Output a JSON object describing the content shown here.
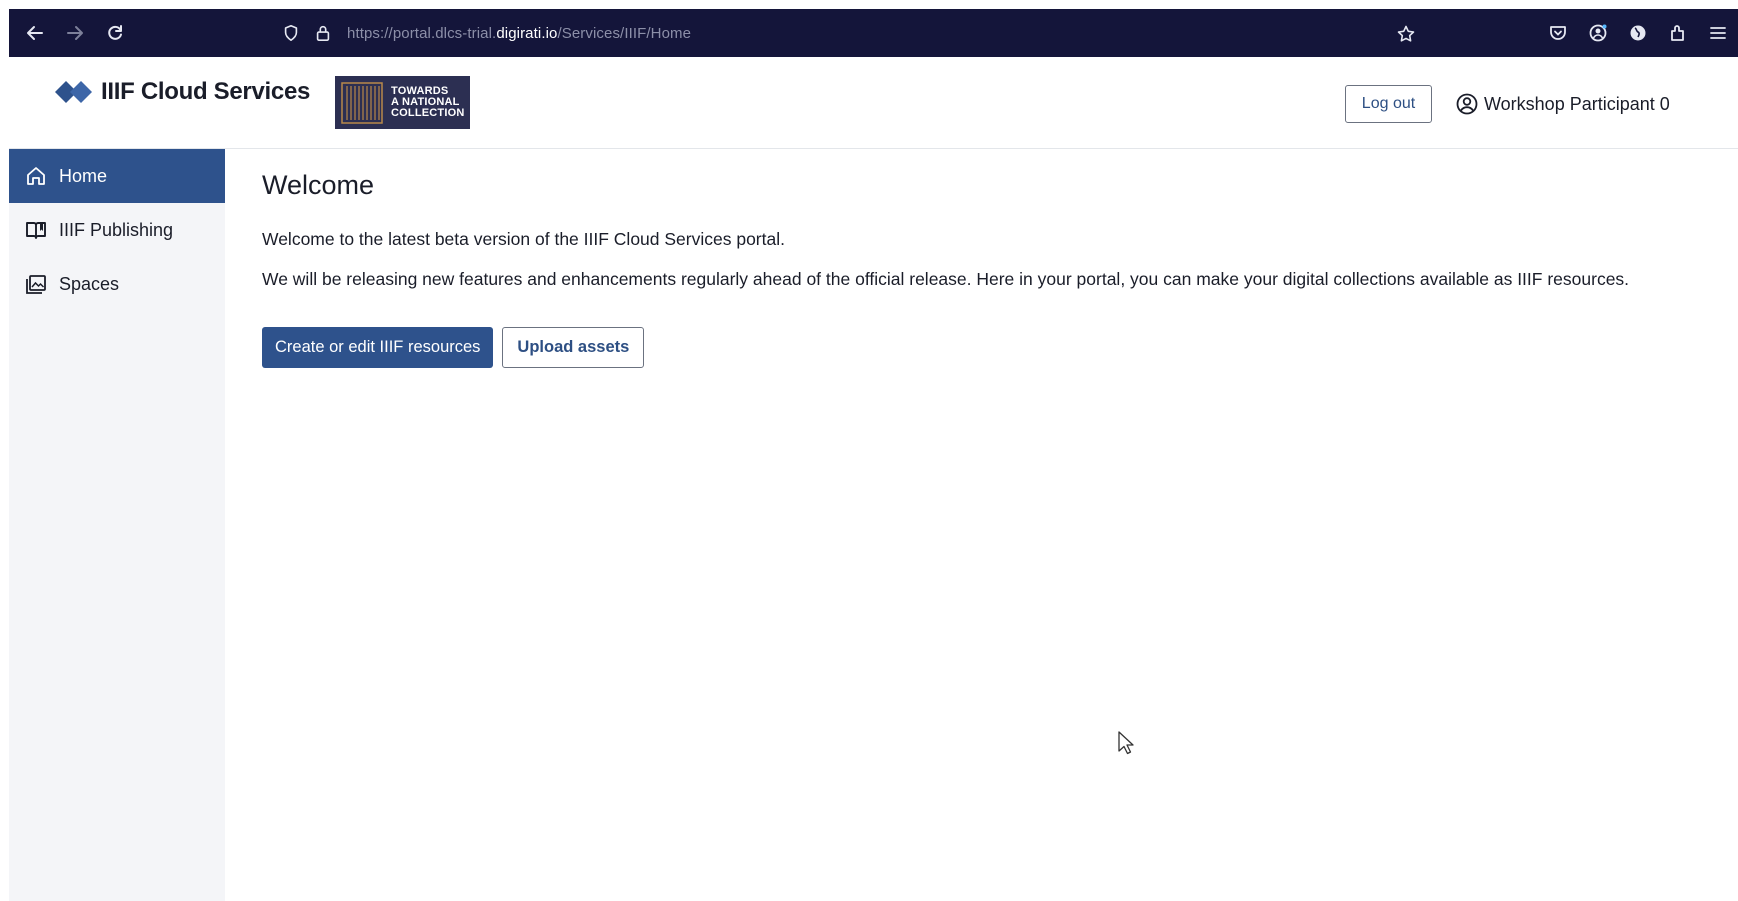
{
  "browser": {
    "url_prefix": "https://portal.dlcs-trial.",
    "url_domain": "digirati.io",
    "url_path": "/Services/IIIF/Home"
  },
  "header": {
    "app_title": "IIIF Cloud Services",
    "partner_badge": {
      "line1": "TOWARDS",
      "line2": "A NATIONAL",
      "line3": "COLLECTION"
    },
    "logout_label": "Log out",
    "user_name": "Workshop Participant 0"
  },
  "sidebar": {
    "items": [
      {
        "label": "Home",
        "icon": "home-icon",
        "active": true
      },
      {
        "label": "IIIF Publishing",
        "icon": "book-icon",
        "active": false
      },
      {
        "label": "Spaces",
        "icon": "spaces-icon",
        "active": false
      }
    ]
  },
  "main": {
    "title": "Welcome",
    "paragraph1": "Welcome to the latest beta version of the IIIF Cloud Services portal.",
    "paragraph2": "We will be releasing new features and enhancements regularly ahead of the official release. Here in your portal, you can make your digital collections available as IIIF resources.",
    "primary_button": "Create or edit IIIF resources",
    "secondary_button": "Upload assets"
  },
  "colors": {
    "browser_bar": "#14153a",
    "accent": "#2e528c",
    "sidebar_bg": "#f4f5f8",
    "badge_bg": "#2c2f52"
  }
}
